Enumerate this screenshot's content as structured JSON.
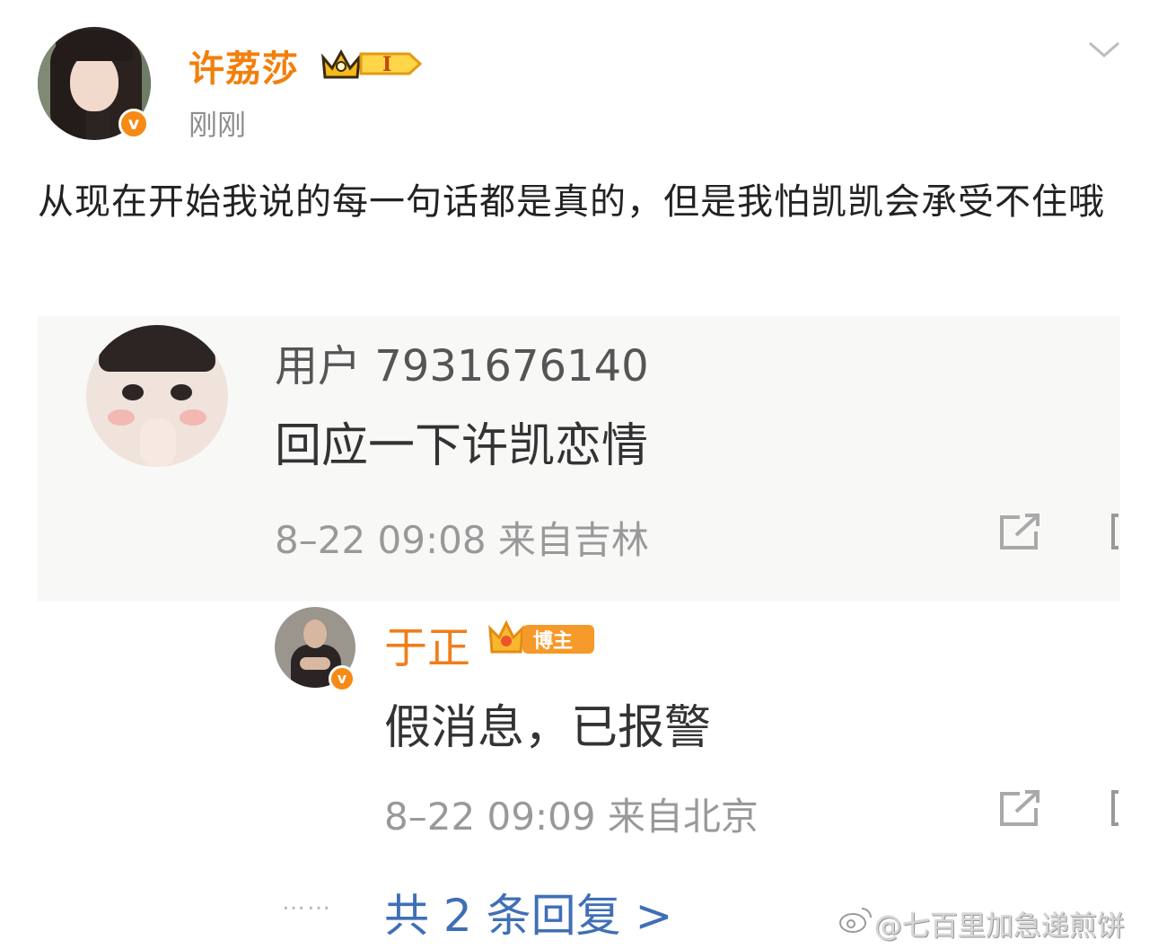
{
  "post": {
    "author": "许荔莎",
    "level_badge": "I",
    "time": "刚刚",
    "verified_mark": "v",
    "text": "从现在开始我说的每一句话都是真的，但是我怕凯凯会承受不住哦"
  },
  "embedded": {
    "comment": {
      "user": "用户 7931676140",
      "text": "回应一下许凯恋情",
      "meta": "8–22 09:08 来自吉林"
    },
    "reply": {
      "user": "于正",
      "badge": "博主",
      "verified_mark": "v",
      "text": "假消息，已报警",
      "meta": "8–22 09:09 来自北京"
    },
    "dots": "……",
    "more_replies": "共 2 条回复 >"
  },
  "watermark": "@七百里加急递煎饼",
  "icons": [
    "chevron-down-icon",
    "crown-icon",
    "share-icon",
    "weibo-logo-icon"
  ],
  "colors": {
    "accent_orange": "#f27f0c",
    "link_blue": "#3f6fb6",
    "badge_orange": "#f68a14"
  }
}
